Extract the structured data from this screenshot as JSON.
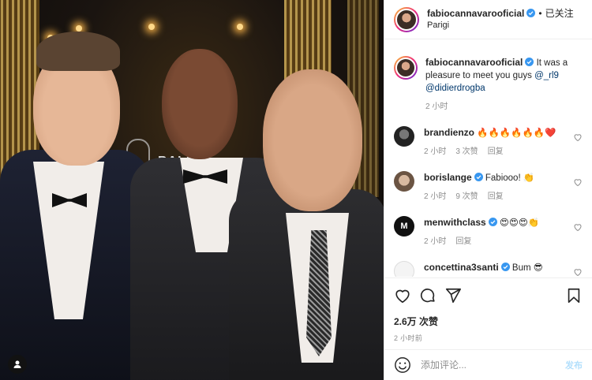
{
  "post": {
    "username": "fabiocannavarooficial",
    "follow_label": "已关注",
    "separator": "•",
    "location": "Parigi",
    "caption_prefix": "It was a pleasure to meet you guys",
    "caption_mentions": [
      "@_rl9",
      "@didierdrogba"
    ],
    "caption_time": "2 小时",
    "likes": "2.6万 次赞",
    "posted_ago": "2 小时前"
  },
  "comments": [
    {
      "username": "brandienzo",
      "verified": false,
      "text": "🔥🔥🔥🔥🔥🔥❤️",
      "time": "2 小时",
      "likes": "3 次赞",
      "reply": "回复"
    },
    {
      "username": "borislange",
      "verified": true,
      "text": "Fabiooo! 👏",
      "time": "2 小时",
      "likes": "9 次赞",
      "reply": "回复"
    },
    {
      "username": "menwithclass",
      "verified": true,
      "text": "😍😍😍👏",
      "time": "2 小时",
      "likes": "",
      "reply": "回复"
    },
    {
      "username": "concettina3santi",
      "verified": true,
      "text": "Bum 😎",
      "time": "",
      "likes": "",
      "reply": ""
    }
  ],
  "add_comment": {
    "placeholder": "添加评论...",
    "post_label": "发布"
  },
  "photo": {
    "backdrop_text": "BALL"
  },
  "colors": {
    "verified": "#3897f0",
    "heart": "#ed4956",
    "meta": "#8e8e8e",
    "mention": "#00376b"
  },
  "icons": [
    "verified-badge-icon",
    "heart-icon",
    "comment-icon",
    "share-icon",
    "bookmark-icon",
    "emoji-icon",
    "user-tag-icon"
  ]
}
